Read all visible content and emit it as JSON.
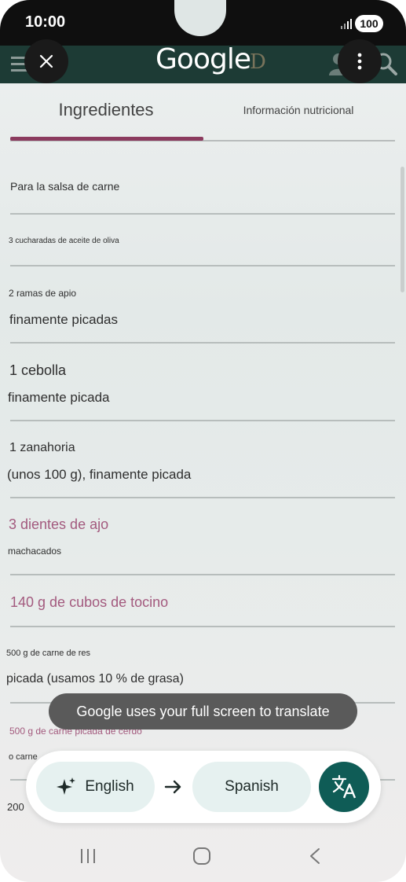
{
  "status_bar": {
    "time": "10:00",
    "battery": "100"
  },
  "header": {
    "logo": "Google",
    "background_logo": "D"
  },
  "tabs": [
    {
      "label": "Ingredientes",
      "active": true
    },
    {
      "label": "Información nutricional",
      "active": false
    }
  ],
  "ingredients": [
    {
      "line1": "Para la salsa de carne"
    },
    {
      "line1": "3 cucharadas de aceite de oliva"
    },
    {
      "line1": "2 ramas de apio",
      "line2": "finamente picadas"
    },
    {
      "line1": "1 cebolla",
      "line2": "finamente picada"
    },
    {
      "line1": "1 zanahoria",
      "line2": "(unos 100 g), finamente picada"
    },
    {
      "line1": "3 dientes de ajo",
      "line2": "machacados"
    },
    {
      "line1": "140 g de cubos de tocino"
    },
    {
      "line1": "500 g de carne de res",
      "line2": "picada (usamos 10 % de grasa)"
    },
    {
      "line1": "500 g de carne picada de cerdo",
      "line2": "o carne"
    },
    {
      "line1": "200"
    }
  ],
  "toast": "Google uses your full screen to translate",
  "translate": {
    "source_language": "English",
    "target_language": "Spanish",
    "accent": "#0f5c56"
  },
  "colors": {
    "tab_indicator": "#8b3b5e",
    "header": "#1d3b35"
  }
}
